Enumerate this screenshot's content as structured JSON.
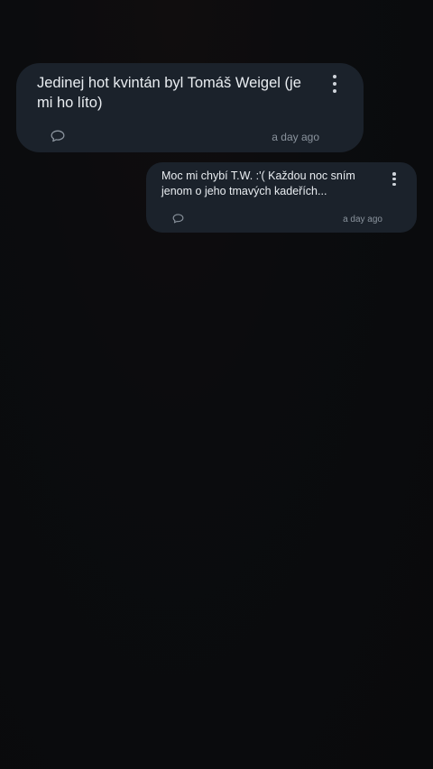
{
  "messages": [
    {
      "text": "Jedinej hot kvintán byl Tomáš Weigel (je mi ho líto)",
      "time": "a day ago",
      "icons": {
        "menu": "more-vertical-icon",
        "reply": "comment-icon"
      }
    },
    {
      "text": "Moc mi chybí T.W. :'( Každou noc sním jenom o jeho tmavých kadeřích...",
      "time": "a day ago",
      "icons": {
        "menu": "more-vertical-icon",
        "reply": "comment-icon"
      }
    }
  ],
  "colors": {
    "background": "#0a0b0d",
    "bubble": "#1b222b",
    "text": "#e9edf1",
    "muted": "#8a939d"
  }
}
